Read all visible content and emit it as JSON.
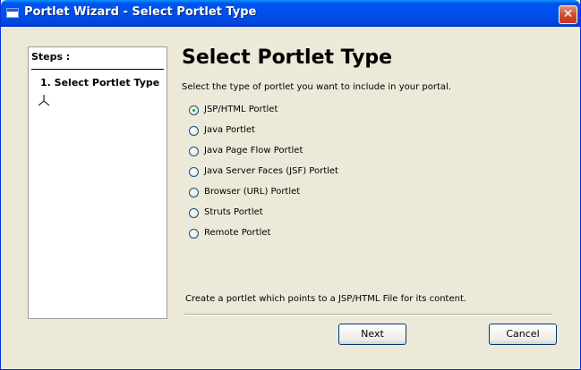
{
  "window": {
    "title": "Portlet Wizard - Select Portlet Type",
    "close_glyph": "✕"
  },
  "steps": {
    "heading": "Steps :",
    "items": [
      {
        "label": "1. Select Portlet Type"
      }
    ]
  },
  "main": {
    "title": "Select Portlet Type",
    "description": "Select the type of portlet you want to include in your portal.",
    "options": [
      {
        "label": "JSP/HTML Portlet",
        "selected": true
      },
      {
        "label": "Java Portlet",
        "selected": false
      },
      {
        "label": "Java Page Flow Portlet",
        "selected": false
      },
      {
        "label": "Java Server Faces (JSF) Portlet",
        "selected": false
      },
      {
        "label": "Browser (URL) Portlet",
        "selected": false
      },
      {
        "label": "Struts Portlet",
        "selected": false
      },
      {
        "label": "Remote Portlet",
        "selected": false
      }
    ],
    "help_text": "Create a portlet which points to a JSP/HTML File for its content."
  },
  "buttons": {
    "next_label": "Next",
    "cancel_label": "Cancel"
  },
  "colors": {
    "titlebar": "#0053ee",
    "dialog_bg": "#ece9d8",
    "close_button": "#d0472a"
  }
}
